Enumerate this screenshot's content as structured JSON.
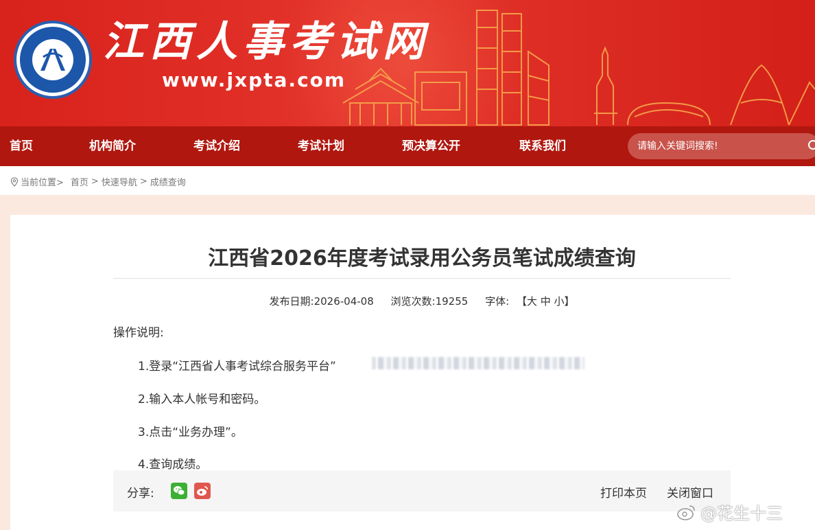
{
  "header": {
    "site_title": "江西人事考试网",
    "site_url": "www.jxpta.com"
  },
  "nav": {
    "items": [
      {
        "label": "首页"
      },
      {
        "label": "机构简介"
      },
      {
        "label": "考试介绍"
      },
      {
        "label": "考试计划"
      },
      {
        "label": "预决算公开"
      },
      {
        "label": "联系我们"
      }
    ],
    "search_placeholder": "请输入关键词搜索!"
  },
  "breadcrumb": {
    "prefix": "当前位置>",
    "items": [
      "首页",
      "快速导航",
      "成绩查询"
    ],
    "separator": ">"
  },
  "article": {
    "title": "江西省2026年度考试录用公务员笔试成绩查询",
    "publish_label": "发布日期:",
    "publish_date": "2026-04-08",
    "views_label": "浏览次数:",
    "views": "19255",
    "font_label": "字体:",
    "font_sizes": "【大 中 小】",
    "instructions_heading": "操作说明:",
    "steps": [
      "1.登录“江西省人事考试综合服务平台”",
      "2.输入本人帐号和密码。",
      "3.点击“业务办理”。",
      "4.查询成绩。"
    ]
  },
  "share": {
    "label": "分享:",
    "print_label": "打印本页",
    "close_label": "关闭窗口"
  },
  "watermark": "@花生十三",
  "colors": {
    "banner_red": "#d8221c",
    "nav_red": "#b0170f",
    "page_bg": "#fbe9df",
    "wechat_green": "#3cb034",
    "weibo_red": "#e0574e"
  }
}
